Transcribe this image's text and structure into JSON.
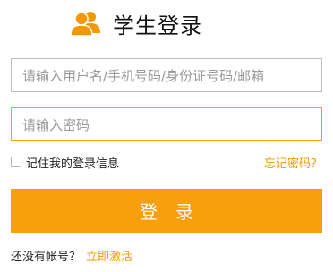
{
  "header": {
    "title": "学生登录",
    "icon": "users-icon"
  },
  "form": {
    "account_placeholder": "请输入用户名/手机号码/身份证号码/邮箱",
    "password_placeholder": "请输入密码",
    "remember_label": "记住我的登录信息",
    "remember_checked": false,
    "forgot_label": "忘记密码？",
    "login_label": "登录"
  },
  "footer": {
    "no_account_text": "还没有帐号？",
    "activate_label": "立即激活"
  },
  "colors": {
    "accent": "#f7a00b",
    "link": "#f39800",
    "active_border": "#f0a10a"
  }
}
